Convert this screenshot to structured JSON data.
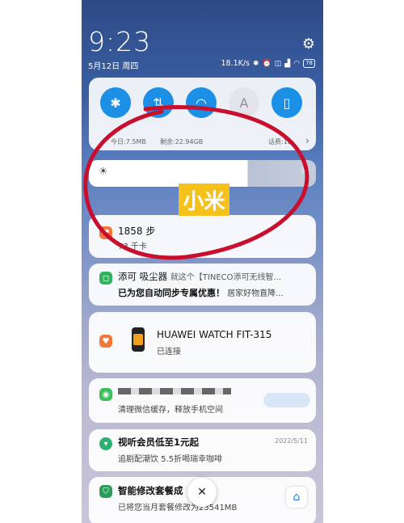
{
  "status": {
    "time": "9:23",
    "date": "5月12日 周四",
    "net_speed": "18.1K/s",
    "icons": [
      "bluetooth-icon",
      "alarm-icon",
      "mute-icon",
      "signal-icon",
      "wifi-icon",
      "battery-icon"
    ],
    "battery": "78"
  },
  "quick_settings": {
    "tiles": [
      {
        "icon": "bluetooth-icon",
        "glyph": "✱"
      },
      {
        "icon": "data-icon",
        "glyph": "⇅"
      },
      {
        "icon": "wifi-icon",
        "glyph": "◠"
      },
      {
        "icon": "auto-brightness-icon",
        "glyph": "A"
      },
      {
        "icon": "vibrate-icon",
        "glyph": "▯"
      }
    ],
    "today": "今日:7.5MB",
    "remaining": "剩余:22.94GB",
    "fee": "话费:10",
    "chevron": "›"
  },
  "watermark": "小米",
  "notifications": [
    {
      "title": "1858 步",
      "body": "73 千卡"
    },
    {
      "title": "添可 吸尘器",
      "title_suffix": "就这个【TINECO添可无线智...",
      "body_bold": "已为您自动同步专属优惠！",
      "body_suffix": "居家好物直降..."
    },
    {
      "title": "HUAWEI WATCH FIT-315",
      "body": "已连接"
    },
    {
      "body": "清理微信缓存，释放手机空间"
    },
    {
      "title": "视听会员低至1元起",
      "body": "追剧配潮饮 5.5折喝瑞幸咖啡",
      "time": "2022/5/11"
    },
    {
      "title": "智能修改套餐成",
      "body": "已将您当月套餐修改为23541MB",
      "close": "✕"
    }
  ]
}
